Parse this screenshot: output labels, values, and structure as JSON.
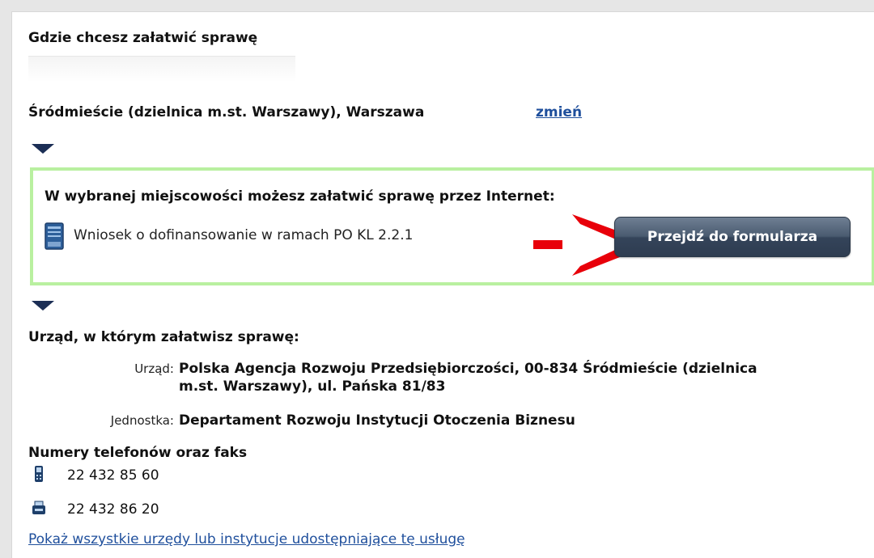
{
  "section": {
    "where_title": "Gdzie chcesz załatwić sprawę",
    "location": "Śródmieście (dzielnica m.st. Warszawy), Warszawa",
    "change_link": "zmień"
  },
  "online": {
    "title": "W wybranej miejscowości możesz załatwić sprawę przez Internet:",
    "form_label": "Wniosek o dofinansowanie w ramach PO KL 2.2.1",
    "button_label": "Przejdź do formularza",
    "form_icon": "form-document-icon",
    "highlight_color": "#b9f0a0",
    "arrow_color": "#e8000a"
  },
  "office": {
    "title": "Urząd, w którym załatwisz sprawę:",
    "office_key": "Urząd:",
    "office_value": "Polska Agencja Rozwoju Przedsiębiorczości, 00-834 Śródmieście (dzielnica m.st. Warszawy), ul. Pańska 81/83",
    "unit_key": "Jednostka:",
    "unit_value": "Departament Rozwoju Instytucji Otoczenia Biznesu"
  },
  "phones": {
    "title": "Numery telefonów oraz faks",
    "phone": "22 432 85 60",
    "fax": "22 432 86 20",
    "phone_icon": "phone-icon",
    "fax_icon": "fax-icon"
  },
  "links": {
    "all_offices": "Pokaż wszystkie urzędy lub instytucje udostępniające tę usługę"
  },
  "colors": {
    "link": "#1f4f9c",
    "button": "#3f4f63",
    "triangle": "#1b2e55"
  }
}
